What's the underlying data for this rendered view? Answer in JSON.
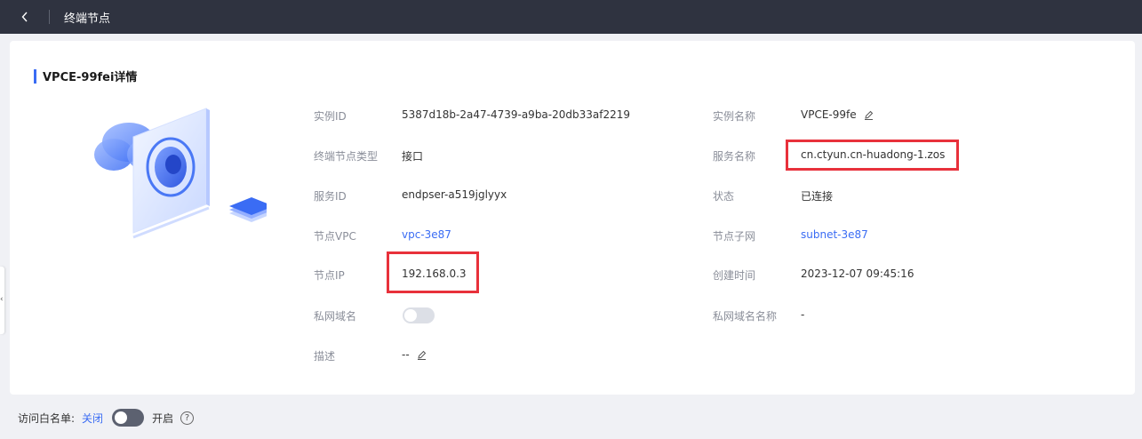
{
  "header": {
    "title": "终端节点"
  },
  "detail": {
    "section_title": "VPCE-99fei详情",
    "fields": {
      "instance_id": {
        "label": "实例ID",
        "value": "5387d18b-2a47-4739-a9ba-20db33af2219"
      },
      "instance_name": {
        "label": "实例名称",
        "value": "VPCE-99fe"
      },
      "endpoint_type": {
        "label": "终端节点类型",
        "value": "接口"
      },
      "service_name": {
        "label": "服务名称",
        "value": "cn.ctyun.cn-huadong-1.zos"
      },
      "service_id": {
        "label": "服务ID",
        "value": "endpser-a519jglyyx"
      },
      "status": {
        "label": "状态",
        "value": "已连接"
      },
      "node_vpc": {
        "label": "节点VPC",
        "value": "vpc-3e87"
      },
      "node_subnet": {
        "label": "节点子网",
        "value": "subnet-3e87"
      },
      "node_ip": {
        "label": "节点IP",
        "value": "192.168.0.3"
      },
      "created_time": {
        "label": "创建时间",
        "value": "2023-12-07 09:45:16"
      },
      "private_dns": {
        "label": "私网域名",
        "enabled": false
      },
      "private_dns_name": {
        "label": "私网域名名称",
        "value": "-"
      },
      "description": {
        "label": "描述",
        "value": "--"
      }
    }
  },
  "footer": {
    "whitelist_label": "访问白名单:",
    "off_label": "关闭",
    "on_label": "开启",
    "enabled": false
  },
  "colors": {
    "accent": "#3a6cf4",
    "highlight": "#e8313b",
    "topbar": "#2f3340"
  }
}
